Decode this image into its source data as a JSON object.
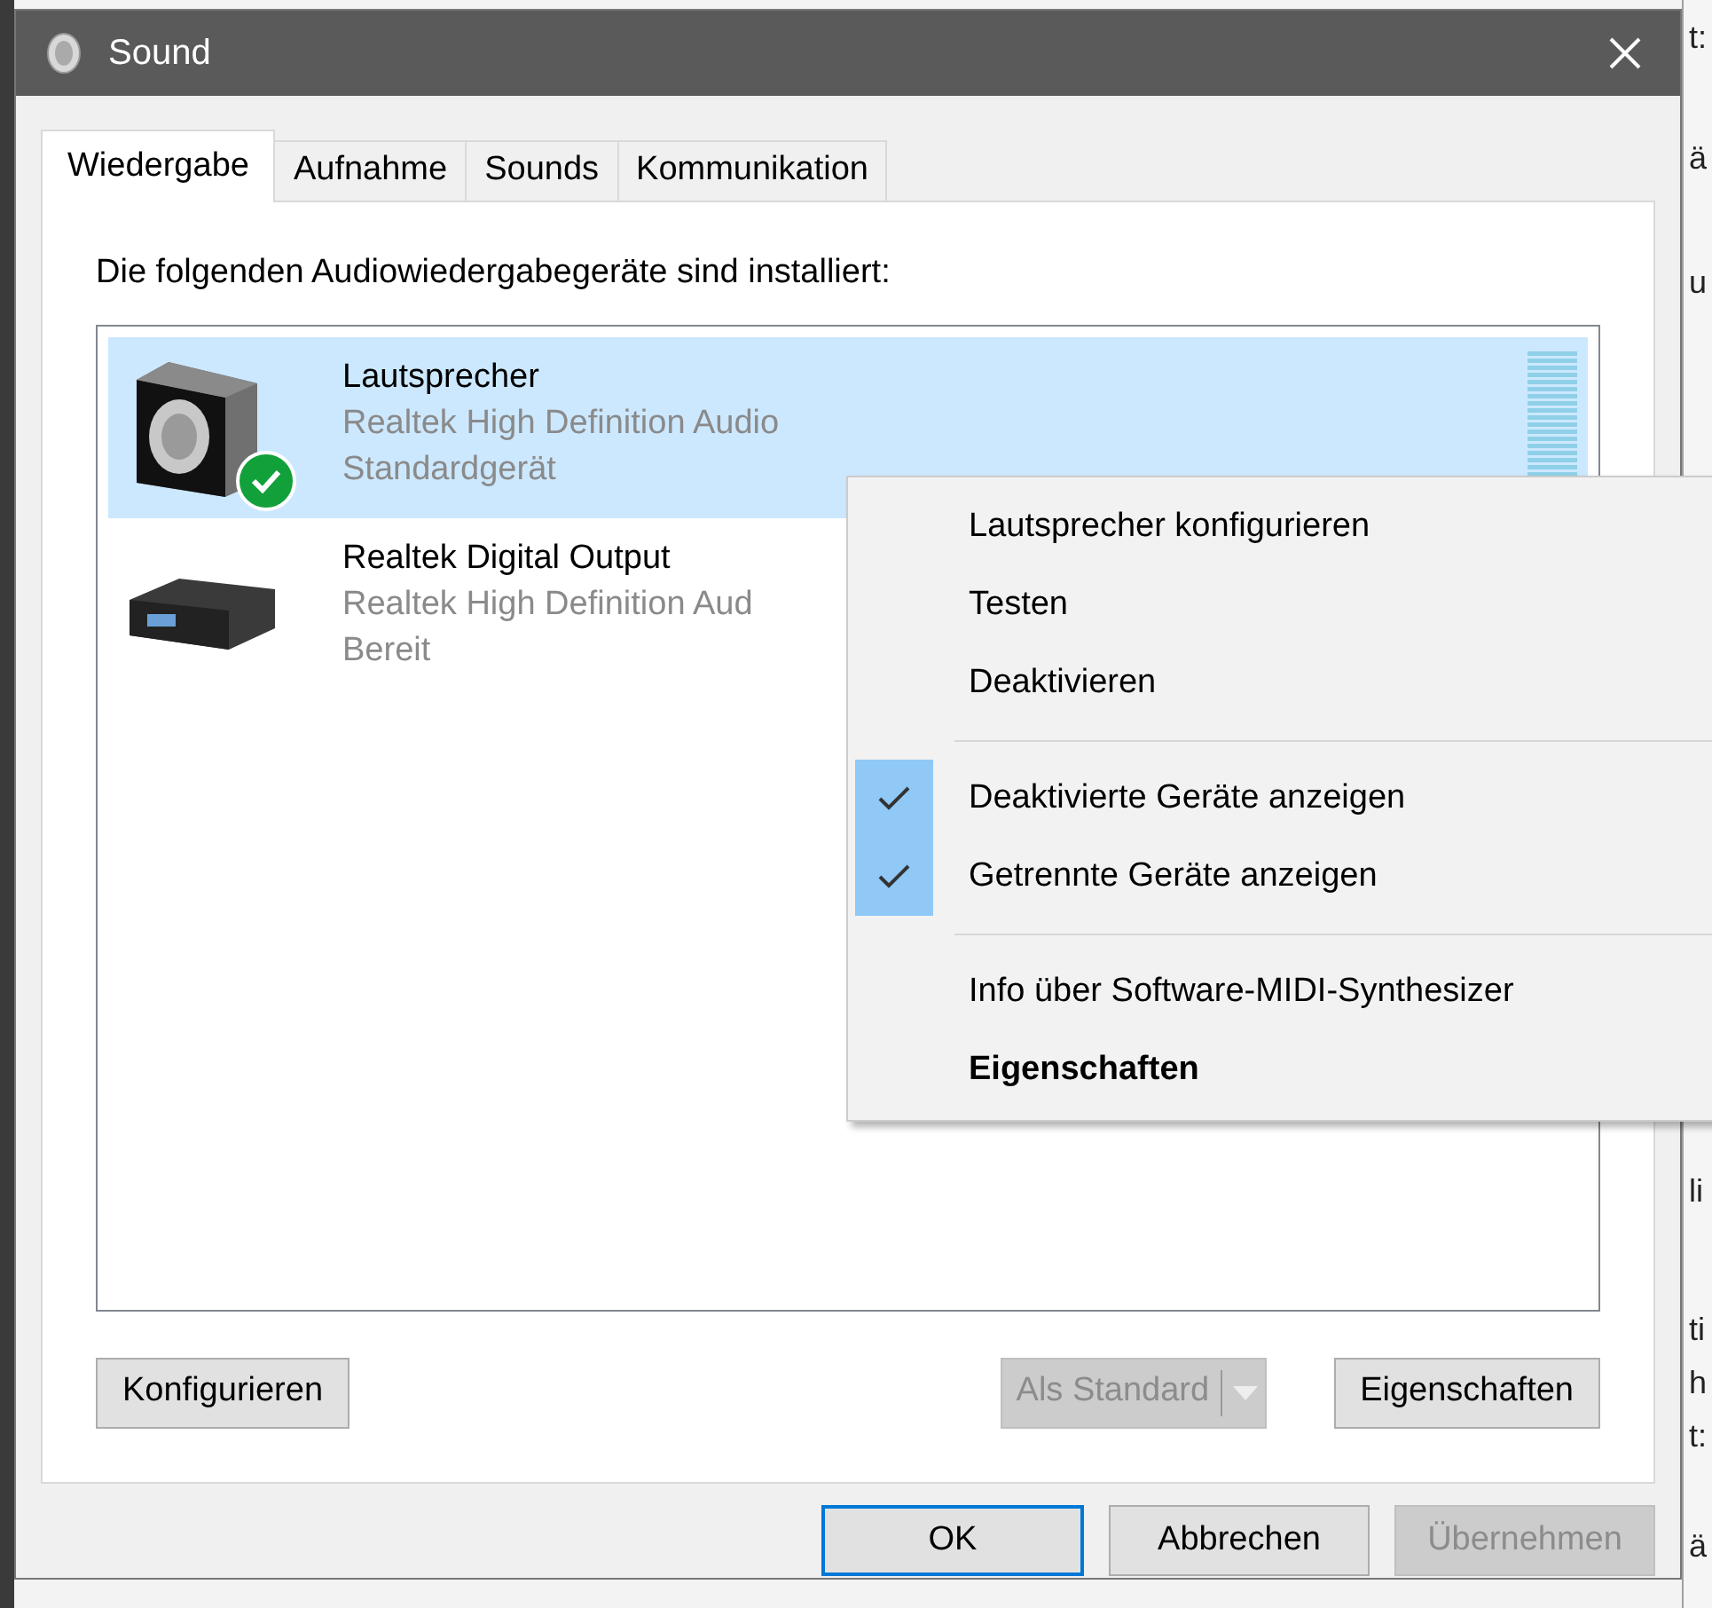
{
  "window": {
    "title": "Sound"
  },
  "tabs": [
    {
      "label": "Wiedergabe",
      "selected": true
    },
    {
      "label": "Aufnahme",
      "selected": false
    },
    {
      "label": "Sounds",
      "selected": false
    },
    {
      "label": "Kommunikation",
      "selected": false
    }
  ],
  "intro": "Die folgenden Audiowiedergabegeräte sind installiert:",
  "devices": [
    {
      "kind": "speaker",
      "name": "Lautsprecher",
      "driver": "Realtek High Definition Audio",
      "status": "Standardgerät",
      "selected": true,
      "default": true
    },
    {
      "kind": "digital",
      "name": "Realtek Digital Output",
      "driver": "Realtek High Definition Aud",
      "status": "Bereit",
      "selected": false,
      "default": false
    }
  ],
  "panel_buttons": [
    {
      "label": "Konfigurieren",
      "disabled": false,
      "kind": "button"
    },
    {
      "label": "Als Standard",
      "disabled": true,
      "kind": "split"
    },
    {
      "label": "Eigenschaften",
      "disabled": false,
      "kind": "button"
    }
  ],
  "dialog_buttons": [
    {
      "label": "OK",
      "disabled": false,
      "focused": true
    },
    {
      "label": "Abbrechen",
      "disabled": false,
      "focused": false
    },
    {
      "label": "Übernehmen",
      "disabled": true,
      "focused": false
    }
  ],
  "context_menu": [
    {
      "kind": "item",
      "label": "Lautsprecher konfigurieren",
      "checked": false,
      "bold": false
    },
    {
      "kind": "item",
      "label": "Testen",
      "checked": false,
      "bold": false
    },
    {
      "kind": "item",
      "label": "Deaktivieren",
      "checked": false,
      "bold": false
    },
    {
      "kind": "separator"
    },
    {
      "kind": "item",
      "label": "Deaktivierte Geräte anzeigen",
      "checked": true,
      "bold": false
    },
    {
      "kind": "item",
      "label": "Getrennte Geräte anzeigen",
      "checked": true,
      "bold": false
    },
    {
      "kind": "separator"
    },
    {
      "kind": "item",
      "label": "Info über Software-MIDI-Synthesizer",
      "checked": false,
      "bold": false
    },
    {
      "kind": "item",
      "label": "Eigenschaften",
      "checked": false,
      "bold": true
    }
  ],
  "background_window": {
    "fragments": [
      "t:",
      "ä",
      "u",
      "li",
      "ti",
      "h",
      "t:",
      "ä"
    ]
  }
}
